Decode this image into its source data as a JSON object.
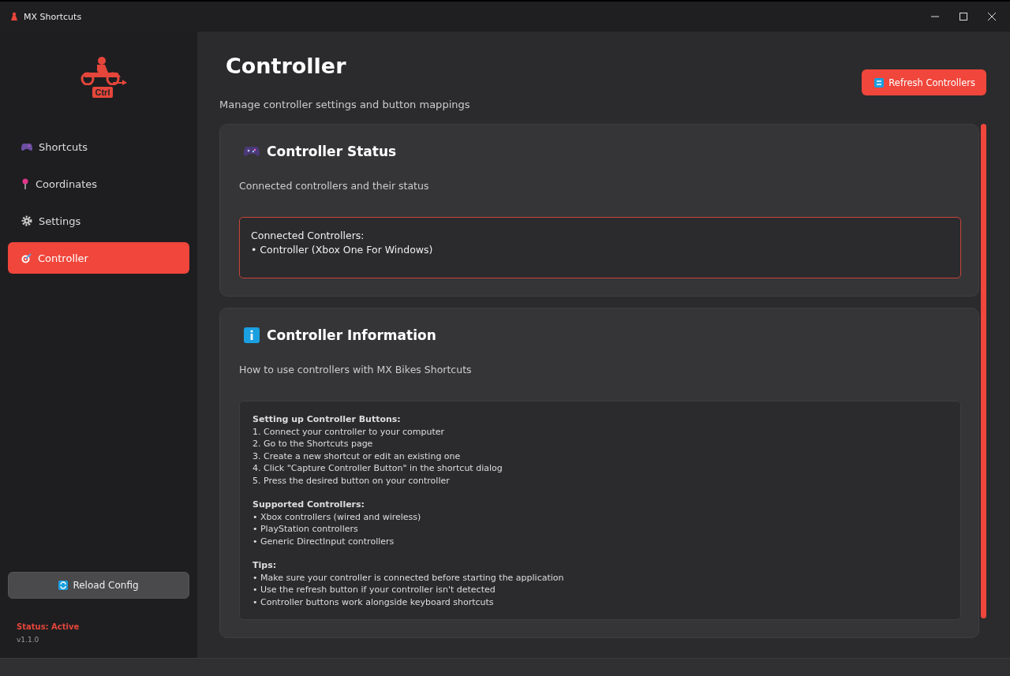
{
  "window": {
    "title": "MX Shortcuts"
  },
  "sidebar": {
    "logo_text": "Ctrl",
    "items": [
      {
        "label": "Shortcuts",
        "kind": "gamepad",
        "selected": false
      },
      {
        "label": "Coordinates",
        "kind": "pin",
        "selected": false
      },
      {
        "label": "Settings",
        "kind": "gear",
        "selected": false
      },
      {
        "label": "Controller",
        "kind": "target",
        "selected": true
      }
    ],
    "reload_button": "Reload Config",
    "status": "Status: Active",
    "version": "v1.1.0"
  },
  "page": {
    "title": "Controller",
    "subtitle": "Manage controller settings and button mappings",
    "refresh_button": "Refresh Controllers"
  },
  "cards": [
    {
      "title": "Controller Status",
      "description": "Connected controllers and their status",
      "kind": "status",
      "box_lines": [
        "Connected Controllers:",
        "• Controller (Xbox One For Windows)"
      ]
    },
    {
      "title": "Controller Information",
      "description": "How to use controllers with MX Bikes Shortcuts",
      "kind": "info",
      "sections": [
        {
          "heading": "Setting up Controller Buttons:",
          "lines": [
            "1. Connect your controller to your computer",
            "2. Go to the Shortcuts page",
            "3. Create a new shortcut or edit an existing one",
            "4. Click \"Capture Controller Button\" in the shortcut dialog",
            "5. Press the desired button on your controller"
          ]
        },
        {
          "heading": "Supported Controllers:",
          "lines": [
            "• Xbox controllers (wired and wireless)",
            "• PlayStation controllers",
            "• Generic DirectInput controllers"
          ]
        },
        {
          "heading": "Tips:",
          "lines": [
            "• Make sure your controller is connected before starting the application",
            "• Use the refresh button if your controller isn't detected",
            "• Controller buttons work alongside keyboard shortcuts"
          ]
        }
      ]
    }
  ]
}
